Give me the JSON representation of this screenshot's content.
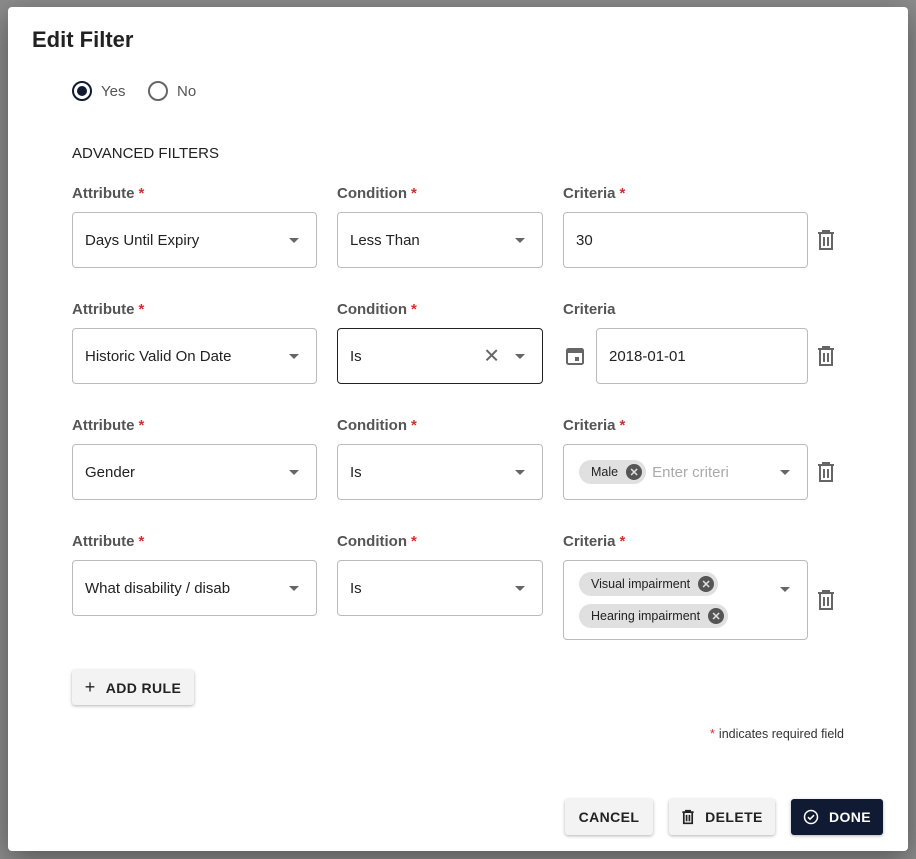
{
  "dialog": {
    "title": "Edit Filter"
  },
  "radio": {
    "options": [
      {
        "label": "Yes",
        "selected": true
      },
      {
        "label": "No",
        "selected": false
      }
    ]
  },
  "section_title": "ADVANCED FILTERS",
  "labels": {
    "attribute": "Attribute",
    "condition": "Condition",
    "criteria": "Criteria",
    "required_mark": "*"
  },
  "rules": [
    {
      "attribute": "Days Until Expiry",
      "condition": "Less Than",
      "criteria": "30",
      "criteria_required": true
    },
    {
      "attribute": "Historic Valid On Date",
      "condition": "Is",
      "criteria": "2018-01-01",
      "criteria_required": false
    },
    {
      "attribute": "Gender",
      "condition": "Is",
      "chips": [
        "Male"
      ],
      "placeholder": "Enter criteri",
      "criteria_required": true
    },
    {
      "attribute": "What disability / disab",
      "condition": "Is",
      "chips": [
        "Visual impairment",
        "Hearing impairment"
      ],
      "criteria_required": true
    }
  ],
  "add_rule": "ADD RULE",
  "required_note": "indicates required field",
  "buttons": {
    "cancel": "CANCEL",
    "delete": "DELETE",
    "done": "DONE"
  },
  "colors": {
    "primary": "#111a33",
    "required": "#d32f2f"
  }
}
